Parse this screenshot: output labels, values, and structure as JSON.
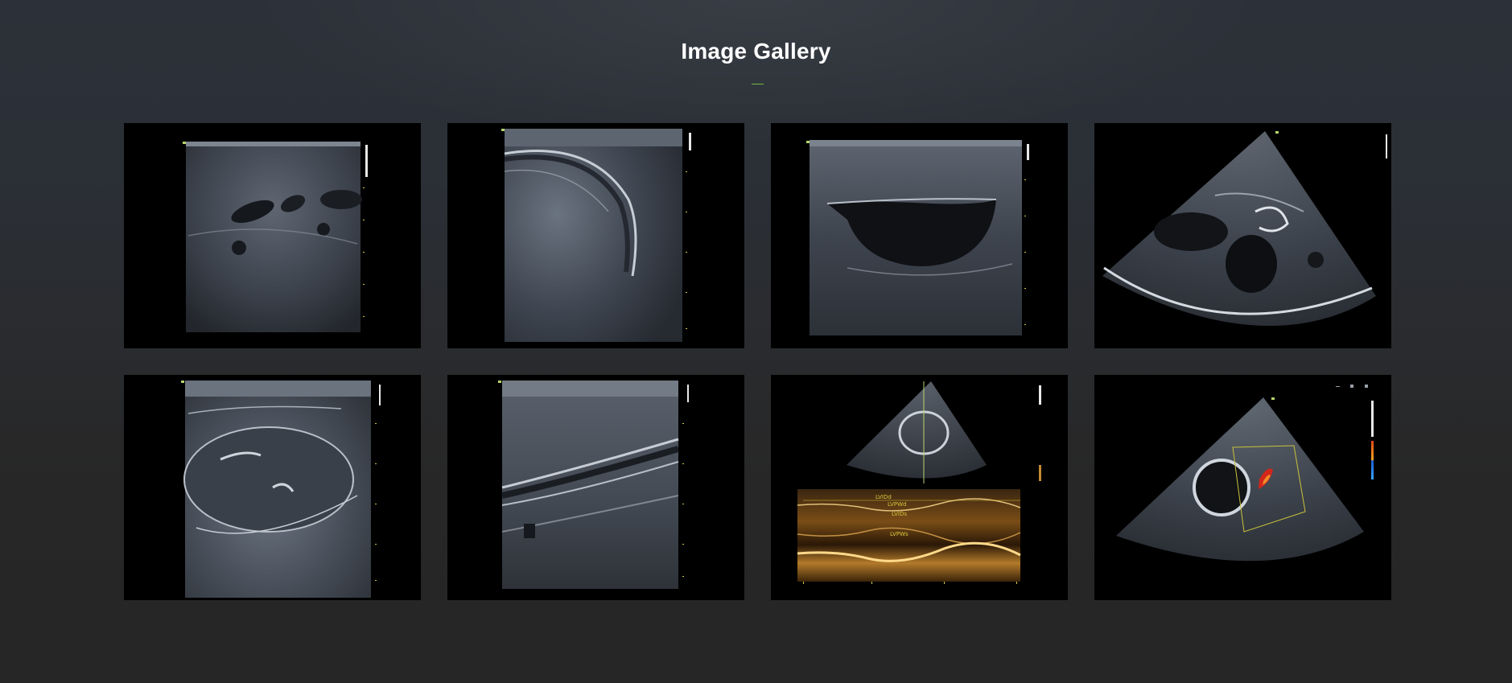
{
  "gallery": {
    "title": "Image Gallery",
    "accent_color": "#7bb23a",
    "images": [
      {
        "name": "ultrasound-image-1",
        "icon": "abdominal-ultrasound"
      },
      {
        "name": "ultrasound-image-2",
        "icon": "liver-ultrasound"
      },
      {
        "name": "ultrasound-image-3",
        "icon": "cyst-ultrasound"
      },
      {
        "name": "ultrasound-image-4",
        "icon": "cardiac-sector-ultrasound"
      },
      {
        "name": "ultrasound-image-5",
        "icon": "kidney-ultrasound"
      },
      {
        "name": "ultrasound-image-6",
        "icon": "vascular-ultrasound"
      },
      {
        "name": "ultrasound-image-7",
        "icon": "m-mode-cardiac-ultrasound",
        "labels": [
          "LVIDd",
          "LVPWd",
          "LVIDs",
          "LVPWs"
        ]
      },
      {
        "name": "ultrasound-image-8",
        "icon": "color-doppler-cardiac-ultrasound"
      }
    ]
  }
}
